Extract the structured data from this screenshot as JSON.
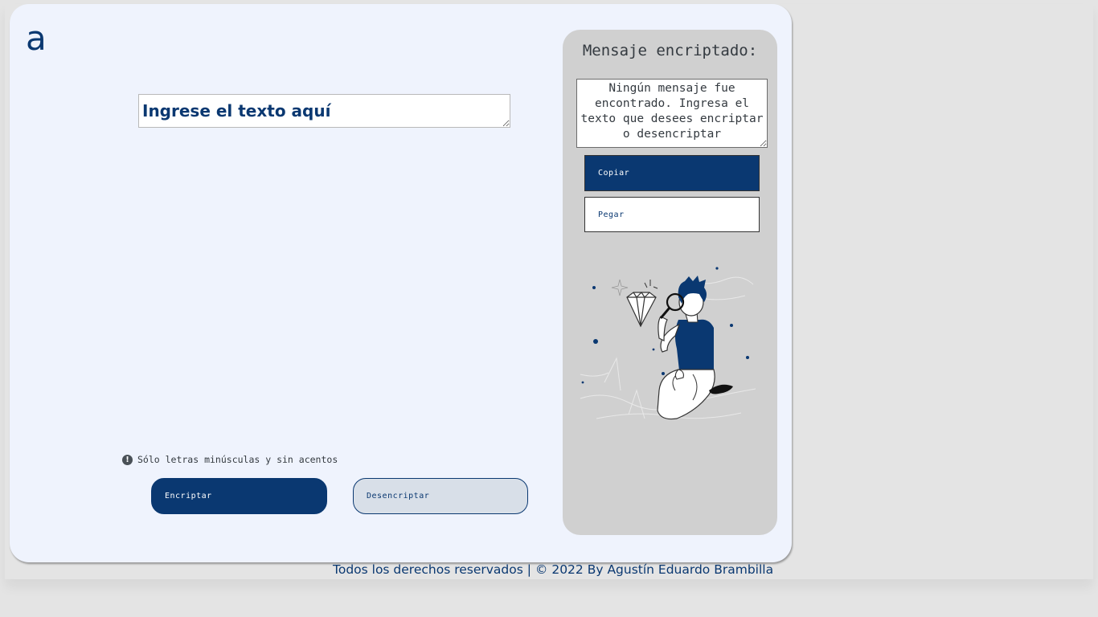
{
  "logo": {
    "text": "a"
  },
  "input": {
    "placeholder": "Ingrese el texto aquí"
  },
  "hint": {
    "icon": "exclamation-circle-icon",
    "text": "Sólo letras minúsculas y sin acentos"
  },
  "buttons": {
    "encrypt": "Encriptar",
    "decrypt": "Desencriptar",
    "copy": "Copiar",
    "paste": "Pegar"
  },
  "panel": {
    "title": "Mensaje encriptado:",
    "output": "Ningún mensaje fue encontrado. Ingresa el texto que desees encriptar o desencriptar"
  },
  "footer": {
    "text": "Todos los derechos reservados | © 2022 By Agustín Eduardo Brambilla"
  },
  "colors": {
    "primary": "#0a3871",
    "card_bg": "#eff3fd",
    "panel_bg": "#d0d0d0",
    "page_bg": "#e4e4e4"
  }
}
